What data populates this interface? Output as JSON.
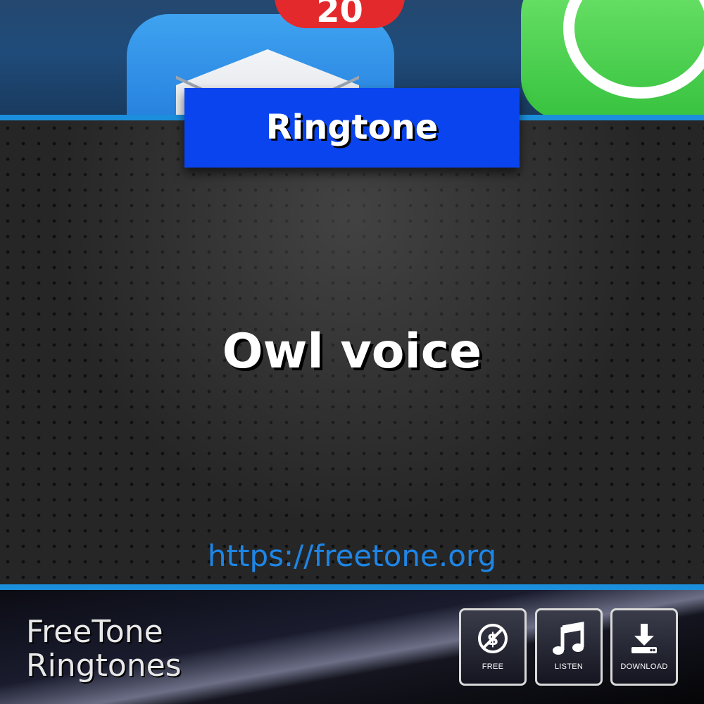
{
  "header": {
    "badge_count": "20",
    "category_label": "Ringtone"
  },
  "main": {
    "title": "Owl voice",
    "url": "https://freetone.org"
  },
  "footer": {
    "brand_line1": "FreeTone",
    "brand_line2": "Ringtones",
    "buttons": [
      {
        "label": "FREE",
        "icon": "no-dollar-icon"
      },
      {
        "label": "LISTEN",
        "icon": "music-note-icon"
      },
      {
        "label": "DOWNLOAD",
        "icon": "download-icon"
      }
    ]
  },
  "colors": {
    "accent_blue": "#0a44ef",
    "line_cyan": "#1b8fdc",
    "url_blue": "#1e86e6",
    "badge_red": "#e3292b"
  }
}
